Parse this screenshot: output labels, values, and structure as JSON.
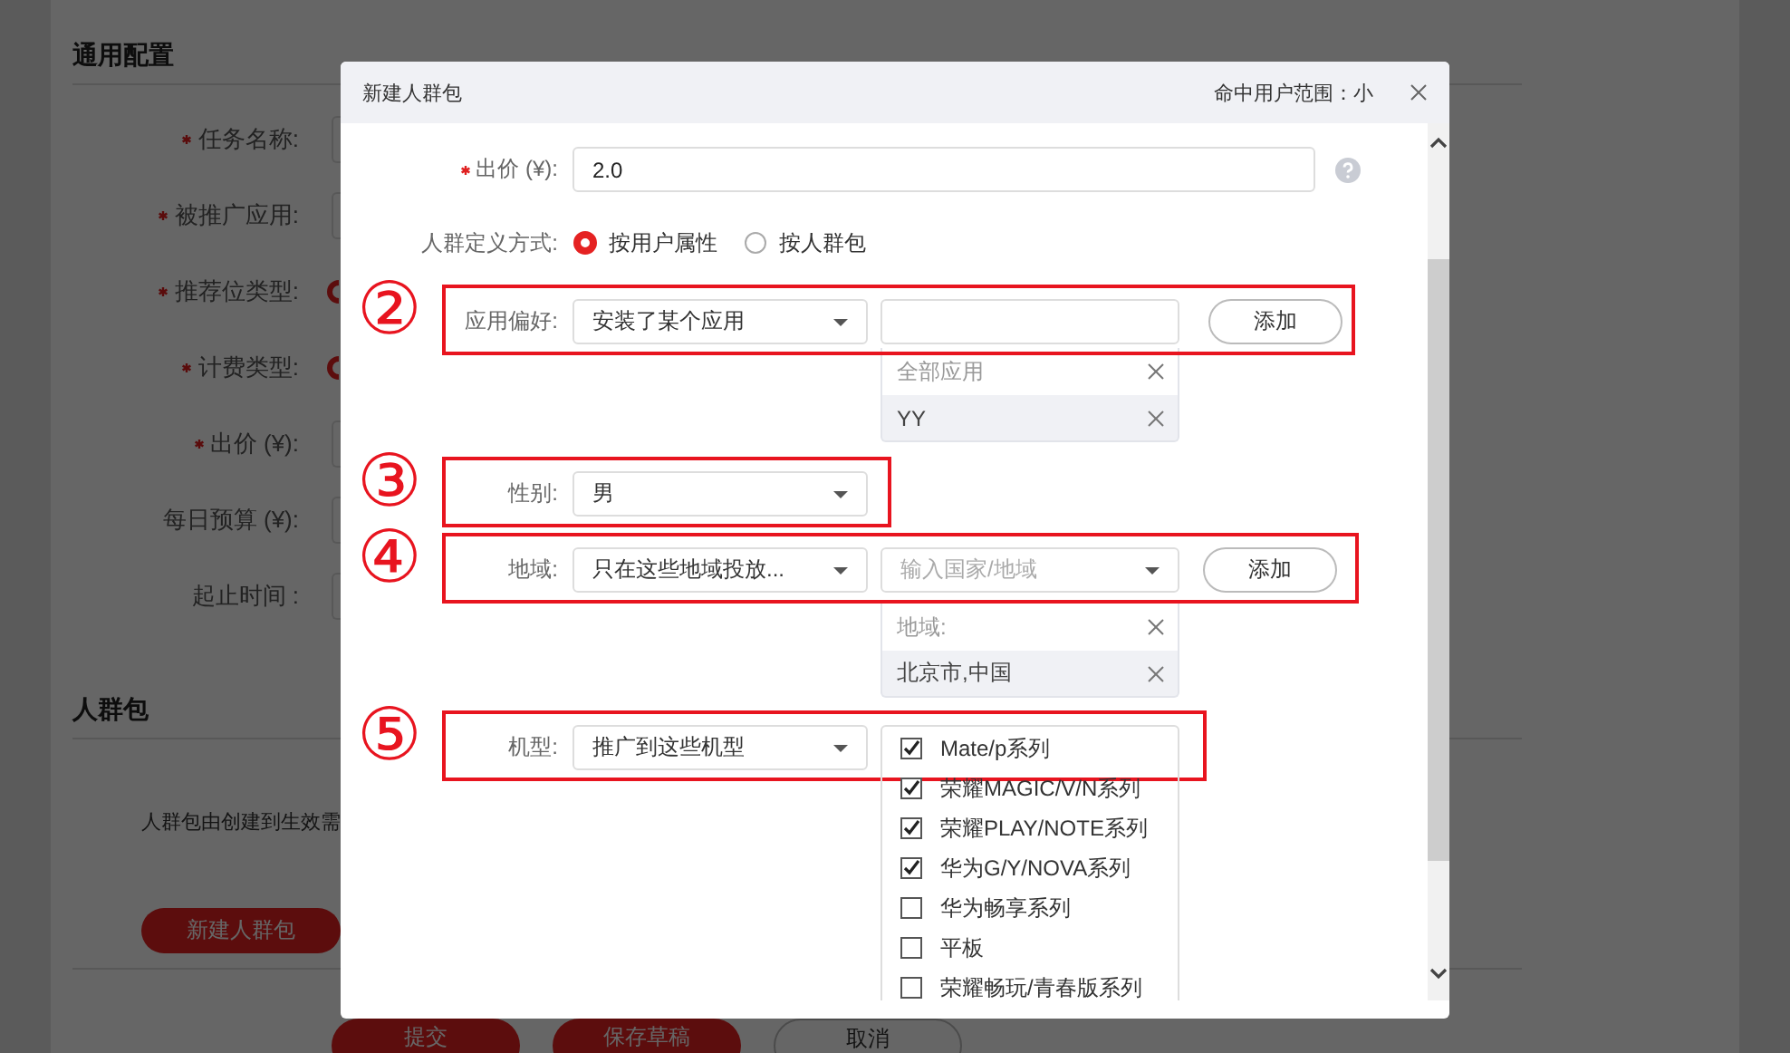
{
  "background_page": {
    "sections": [
      {
        "title": "通用配置",
        "fields": [
          {
            "label": "任务名称:",
            "required": true,
            "kind": "input"
          },
          {
            "label": "被推广应用:",
            "required": true,
            "kind": "input"
          },
          {
            "label": "推荐位类型:",
            "required": true,
            "kind": "radio",
            "selected": true
          },
          {
            "label": "计费类型:",
            "required": true,
            "kind": "radio",
            "selected": true
          },
          {
            "label": "出价 (¥):",
            "required": true,
            "kind": "input"
          },
          {
            "label": "每日预算 (¥):",
            "required": false,
            "kind": "input"
          },
          {
            "label": "起止时间 :",
            "required": false,
            "kind": "input"
          }
        ]
      },
      {
        "title": "人群包",
        "description": "人群包由创建到生效需",
        "button": "新建人群包"
      }
    ],
    "footer_buttons": [
      {
        "label": "提交",
        "kind": "primary"
      },
      {
        "label": "保存草稿",
        "kind": "primary"
      },
      {
        "label": "取消",
        "kind": "secondary"
      }
    ]
  },
  "dialog": {
    "title": "新建人群包",
    "reach": "命中用户范围：小",
    "bid": {
      "label": "出价 (¥):",
      "required": true,
      "value": "2.0"
    },
    "definition": {
      "label": "人群定义方式:",
      "options": [
        {
          "label": "按用户属性",
          "selected": true
        },
        {
          "label": "按人群包",
          "selected": false
        }
      ]
    },
    "criteria": [
      {
        "step": "②",
        "kind": "app",
        "label": "应用偏好:",
        "select": "安装了某个应用",
        "button": "添加",
        "list": {
          "header": "全部应用",
          "items": [
            "YY"
          ]
        }
      },
      {
        "step": "③",
        "kind": "select",
        "label": "性别:",
        "select": "男"
      },
      {
        "step": "④",
        "kind": "region",
        "label": "地域:",
        "select": "只在这些地域投放...",
        "placeholder": "输入国家/地域",
        "button": "添加",
        "list": {
          "header": "地域:",
          "items": [
            "北京市,中国"
          ]
        }
      },
      {
        "step": "⑤",
        "kind": "models",
        "label": "机型:",
        "select": "推广到这些机型",
        "options": [
          {
            "label": "Mate/p系列",
            "checked": true
          },
          {
            "label": "荣耀MAGIC/V/N系列",
            "checked": true
          },
          {
            "label": "荣耀PLAY/NOTE系列",
            "checked": true
          },
          {
            "label": "华为G/Y/NOVA系列",
            "checked": true
          },
          {
            "label": "华为畅享系列",
            "checked": false
          },
          {
            "label": "平板",
            "checked": false
          },
          {
            "label": "荣耀畅玩/青春版系列",
            "checked": false
          }
        ]
      }
    ]
  }
}
